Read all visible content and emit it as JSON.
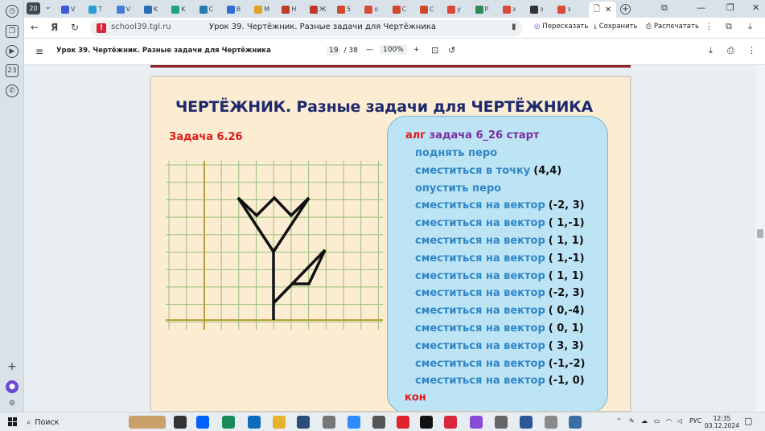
{
  "browser": {
    "tab_count": "20",
    "tabs": [
      {
        "label": "V",
        "color": "#3b5bdb"
      },
      {
        "label": "T",
        "color": "#2a9fd8"
      },
      {
        "label": "V",
        "color": "#4b7bd8"
      },
      {
        "label": "K",
        "color": "#2b6cb0"
      },
      {
        "label": "K",
        "color": "#1fa37a"
      },
      {
        "label": "C",
        "color": "#2a7ab0"
      },
      {
        "label": "B",
        "color": "#2f6fd0"
      },
      {
        "label": "M",
        "color": "#e1a11f"
      },
      {
        "label": "H",
        "color": "#c0392b"
      },
      {
        "label": "Ж",
        "color": "#c0392b"
      },
      {
        "label": "5",
        "color": "#d04a2a"
      },
      {
        "label": "о",
        "color": "#d94a3a"
      },
      {
        "label": "С",
        "color": "#d04a2a"
      },
      {
        "label": "С",
        "color": "#d04a2a"
      },
      {
        "label": "у",
        "color": "#d94a3a"
      },
      {
        "label": "Р",
        "color": "#2e8b57"
      },
      {
        "label": "з",
        "color": "#d94a3a"
      },
      {
        "label": "з",
        "color": "#333333"
      },
      {
        "label": "з",
        "color": "#d94a3a"
      }
    ],
    "active_tab_icon": "document-icon",
    "url": "school39.tgl.ru",
    "page_title": "Урок 39. Чертёжник. Разные задачи для Чертёжника",
    "retell_label": "Пересказать",
    "save_label": "Сохранить",
    "print_label": "Распечатать"
  },
  "pdf": {
    "title": "Урок 39. Чертёжник. Разные задачи для Чертёжника",
    "page_current": "19",
    "page_total": "/ 38",
    "zoom": "100%"
  },
  "slide": {
    "title": "ЧЕРТЁЖНИК. Разные задачи для ЧЕРТЁЖНИКА",
    "task_label": "Задача 6.26",
    "code": {
      "header_kw": "алг",
      "header_name": "задача 6_26 старт",
      "lines": [
        {
          "kw": "поднять перо",
          "arg": ""
        },
        {
          "kw": "сместиться  в точку",
          "arg": "(4,4)"
        },
        {
          "kw": "опустить перо",
          "arg": ""
        },
        {
          "kw": "сместиться на вектор",
          "arg": "(-2, 3)"
        },
        {
          "kw": "сместиться на вектор",
          "arg": "( 1,-1)"
        },
        {
          "kw": "сместиться на вектор",
          "arg": "( 1, 1)"
        },
        {
          "kw": "сместиться на вектор",
          "arg": "( 1,-1)"
        },
        {
          "kw": "сместиться на вектор",
          "arg": "( 1, 1)"
        },
        {
          "kw": "сместиться на вектор",
          "arg": "(-2, 3)"
        },
        {
          "kw": "сместиться на вектор",
          "arg": "( 0,-4)"
        },
        {
          "kw": "сместиться на вектор",
          "arg": "( 0, 1)"
        },
        {
          "kw": "сместиться на вектор",
          "arg": "( 3, 3)"
        },
        {
          "kw": "сместиться на вектор",
          "arg": "(-1,-2)"
        },
        {
          "kw": "сместиться на вектор",
          "arg": "(-1, 0)"
        }
      ],
      "footer_kw": "кон"
    }
  },
  "taskbar": {
    "search_label": "Поиск",
    "lang": "РУС",
    "time": "12:35",
    "date": "03.12.2024"
  }
}
